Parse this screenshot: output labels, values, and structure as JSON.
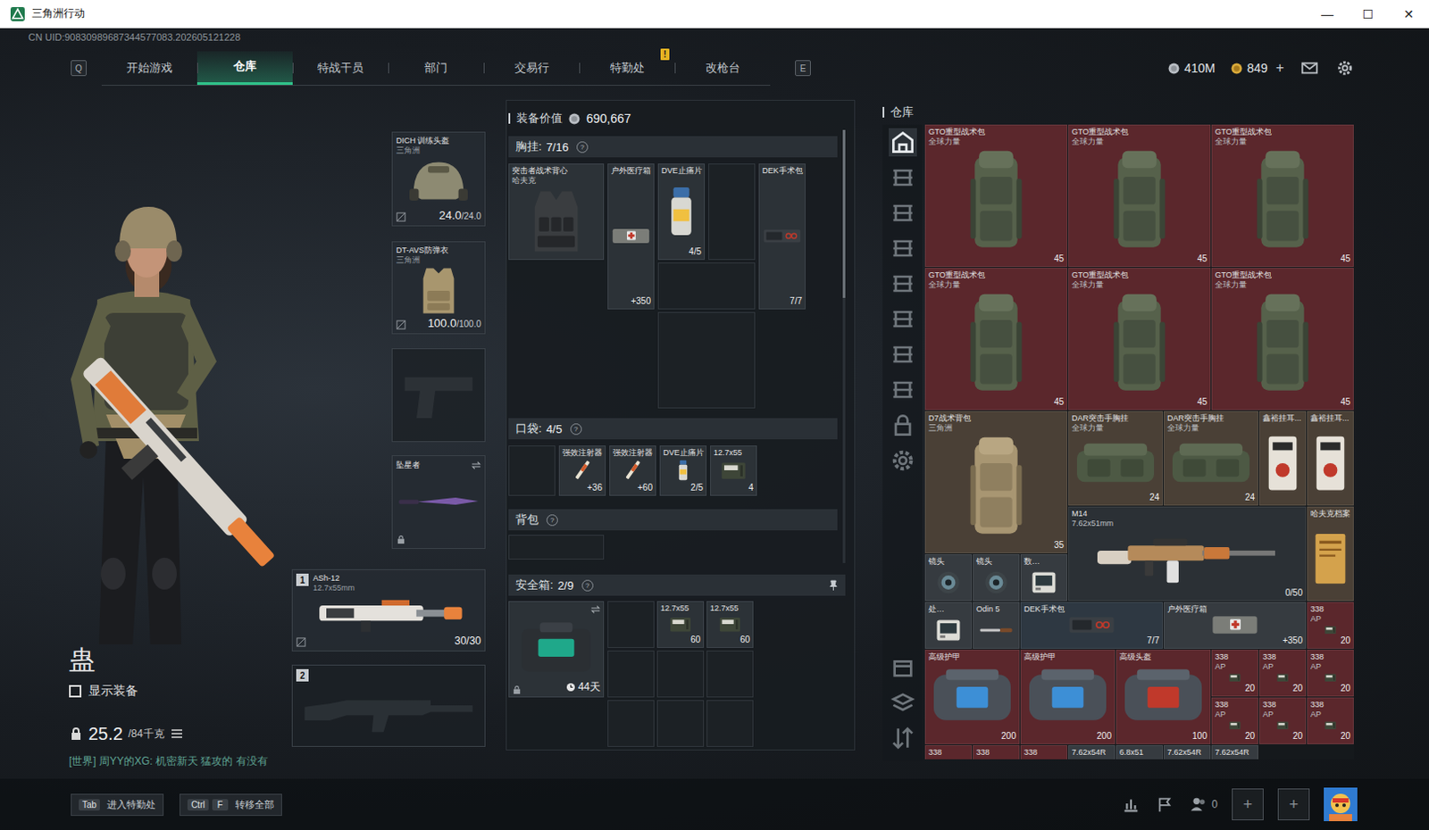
{
  "window": {
    "title": "三角洲行动",
    "controls": [
      "—",
      "☐",
      "✕"
    ]
  },
  "uid": "CN UID:90830989687344577083.202605121228",
  "nav": {
    "prev_key": "Q",
    "next_key": "E",
    "alert": "!",
    "tabs": [
      {
        "label": "开始游戏",
        "selected": false,
        "alert": false
      },
      {
        "label": "仓库",
        "selected": true,
        "alert": false
      },
      {
        "label": "特战干员",
        "selected": false,
        "alert": false
      },
      {
        "label": "部门",
        "selected": false,
        "alert": false
      },
      {
        "label": "交易行",
        "selected": false,
        "alert": false
      },
      {
        "label": "特勤处",
        "selected": false,
        "alert": true
      },
      {
        "label": "改枪台",
        "selected": false,
        "alert": false
      }
    ]
  },
  "currency": {
    "coins": "410M",
    "tokens": "849",
    "add": "+"
  },
  "operator": {
    "name": "蛊",
    "show_gear": {
      "label": "显示装备",
      "checked": false
    },
    "weight": "25.2",
    "weight_max": "/84千克"
  },
  "chat": "[世界] 周YY的XG: 机密新天 猛攻的 有没有",
  "equipment": {
    "helmet": {
      "name": "DICH 训练头盔",
      "brand": "三角洲",
      "value": "24.0",
      "max": "/24.0"
    },
    "armor": {
      "name": "DT-AVS防弹衣",
      "brand": "三角洲",
      "value": "100.0",
      "max": "/100.0"
    },
    "pistol": {
      "empty": true
    },
    "melee": {
      "name": "坠星者",
      "locked": true
    },
    "weapons": [
      {
        "slot": "1",
        "name": "ASh-12",
        "caliber": "12.7x55mm",
        "ammo": "30/30",
        "empty": false
      },
      {
        "slot": "2",
        "empty": true
      }
    ]
  },
  "loadout": {
    "value_label": "装备价值",
    "value": "690,667",
    "help": "?",
    "rig": {
      "title": "胸挂:",
      "count": "7/16",
      "item": {
        "name": "突击者战术背心",
        "brand": "哈夫克"
      },
      "slots": [
        {
          "name": "户外医疗箱",
          "count": "+350",
          "kind": "medkit",
          "empty": false
        },
        {
          "name": "DVE止痛片",
          "count": "4/5",
          "kind": "pill",
          "empty": false
        },
        {
          "empty": true
        },
        {
          "name": "DEK手术包",
          "count": "7/7",
          "kind": "surgkit",
          "empty": false
        },
        {
          "empty": true
        },
        {
          "empty": true
        }
      ]
    },
    "pockets": {
      "title": "口袋:",
      "count": "4/5",
      "slots": [
        {
          "empty": true
        },
        {
          "name": "强效注射器",
          "count": "+36",
          "kind": "syringe",
          "empty": false
        },
        {
          "name": "强效注射器",
          "count": "+60",
          "kind": "syringe",
          "empty": false
        },
        {
          "name": "DVE止痛片",
          "count": "2/5",
          "kind": "pill",
          "empty": false
        },
        {
          "name": "12.7x55",
          "count": "4",
          "kind": "ammo",
          "empty": false
        }
      ]
    },
    "backpack": {
      "title": "背包",
      "empty": true
    },
    "safe": {
      "title": "安全箱:",
      "count": "2/9",
      "days": "44天",
      "slots": [
        {
          "empty": true
        },
        {
          "name": "12.7x55",
          "count": "60",
          "kind": "ammo",
          "empty": false
        },
        {
          "name": "12.7x55",
          "count": "60",
          "kind": "ammo",
          "empty": false
        },
        {
          "empty": true
        },
        {
          "empty": true
        },
        {
          "empty": true
        },
        {
          "empty": true
        },
        {
          "empty": true
        },
        {
          "empty": true
        }
      ]
    }
  },
  "warehouse": {
    "title": "仓库",
    "sidebar": [
      {
        "selected": true
      },
      {
        "selected": false
      },
      {
        "selected": false
      },
      {
        "selected": false
      },
      {
        "selected": false
      },
      {
        "selected": false
      },
      {
        "selected": false
      },
      {
        "selected": false
      },
      {
        "selected": false
      },
      {
        "selected": false
      },
      {
        "selected": false
      },
      {
        "selected": false
      },
      {
        "selected": false
      }
    ],
    "items": [
      {
        "name": "GTO重型战术包",
        "brand": "全球力量",
        "count": "45",
        "kind": "backpack",
        "color": "#5b272c"
      },
      {
        "name": "GTO重型战术包",
        "brand": "全球力量",
        "count": "45",
        "kind": "backpack",
        "color": "#5b272c"
      },
      {
        "name": "GTO重型战术包",
        "brand": "全球力量",
        "count": "45",
        "kind": "backpack",
        "color": "#5b272c"
      },
      {
        "name": "GTO重型战术包",
        "brand": "全球力量",
        "count": "45",
        "kind": "backpack",
        "color": "#5b272c"
      },
      {
        "name": "GTO重型战术包",
        "brand": "全球力量",
        "count": "45",
        "kind": "backpack",
        "color": "#5b272c"
      },
      {
        "name": "GTO重型战术包",
        "brand": "全球力量",
        "count": "45",
        "kind": "backpack",
        "color": "#5b272c"
      },
      {
        "name": "D7战术背包",
        "brand": "三角洲",
        "count": "35",
        "kind": "daypack",
        "color": "#4a4036"
      },
      {
        "name": "DAR突击手胸挂",
        "brand": "全球力量",
        "count": "24",
        "kind": "chestbag",
        "color": "#4a4036"
      },
      {
        "name": "DAR突击手胸挂",
        "brand": "全球力量",
        "count": "24",
        "kind": "chestbag",
        "color": "#4a4036"
      },
      {
        "name": "鑫裕挂耳...",
        "kind": "ear",
        "color": "#4a4036"
      },
      {
        "name": "鑫裕挂耳...",
        "kind": "ear",
        "color": "#4a4036"
      },
      {
        "name": "M14",
        "brand": "7.62x51mm",
        "count": "0/50",
        "kind": "rifle",
        "color": "#2b3035"
      },
      {
        "name": "哈夫克档案",
        "kind": "doc",
        "color": "#4a4036"
      },
      {
        "name": "镜头",
        "kind": "scope",
        "color": "#363b40"
      },
      {
        "name": "镜头",
        "kind": "scope",
        "color": "#363b40"
      },
      {
        "name": "数…",
        "kind": "tablet",
        "color": "#363b40"
      },
      {
        "name": "处…",
        "kind": "tablet",
        "color": "#363b40"
      },
      {
        "name": "Odin 5",
        "kind": "knife",
        "color": "#363b40"
      },
      {
        "name": "DEK手术包",
        "count": "7/7",
        "kind": "surgkit",
        "color": "#2e3842"
      },
      {
        "name": "户外医疗箱",
        "count": "+350",
        "kind": "medkit",
        "color": "#363b40"
      },
      {
        "name": "338",
        "brand": "AP",
        "count": "20",
        "kind": "ammo",
        "color": "#5b272c"
      },
      {
        "name": "高级护甲",
        "count": "200",
        "kind": "armor",
        "color": "#5b272c"
      },
      {
        "name": "高级护甲",
        "count": "200",
        "kind": "armor",
        "color": "#5b272c"
      },
      {
        "name": "高级头盔",
        "count": "100",
        "kind": "helmetcase",
        "color": "#5b272c"
      },
      {
        "name": "338",
        "brand": "AP",
        "count": "20",
        "kind": "ammo",
        "color": "#5b272c"
      },
      {
        "name": "338",
        "brand": "AP",
        "count": "20",
        "kind": "ammo",
        "color": "#5b272c"
      },
      {
        "name": "338",
        "brand": "AP",
        "count": "20",
        "kind": "ammo",
        "color": "#5b272c"
      },
      {
        "name": "338",
        "brand": "AP",
        "count": "20",
        "kind": "ammo",
        "color": "#5b272c"
      },
      {
        "name": "338",
        "brand": "AP",
        "count": "20",
        "kind": "ammo",
        "color": "#5b272c"
      },
      {
        "name": "338",
        "brand": "AP",
        "count": "20",
        "kind": "ammo",
        "color": "#5b272c"
      },
      {
        "name": "338",
        "kind": "ammo",
        "color": "#5b272c"
      },
      {
        "name": "338",
        "kind": "ammo",
        "color": "#5b272c"
      },
      {
        "name": "338",
        "kind": "ammo",
        "color": "#5b272c"
      },
      {
        "name": "7.62x54R",
        "kind": "ammo",
        "color": "#363b40"
      },
      {
        "name": "6.8x51",
        "kind": "ammo",
        "color": "#363b40"
      },
      {
        "name": "7.62x54R",
        "kind": "ammo",
        "color": "#363b40"
      },
      {
        "name": "7.62x54R",
        "kind": "ammo",
        "color": "#363b40"
      }
    ]
  },
  "bottom": {
    "hints": [
      {
        "keys": [
          "Tab"
        ],
        "label": "进入特勤处"
      },
      {
        "keys": [
          "Ctrl",
          "F"
        ],
        "label": "转移全部"
      }
    ],
    "friends": "0",
    "add_slots": [
      "+",
      "+"
    ]
  }
}
